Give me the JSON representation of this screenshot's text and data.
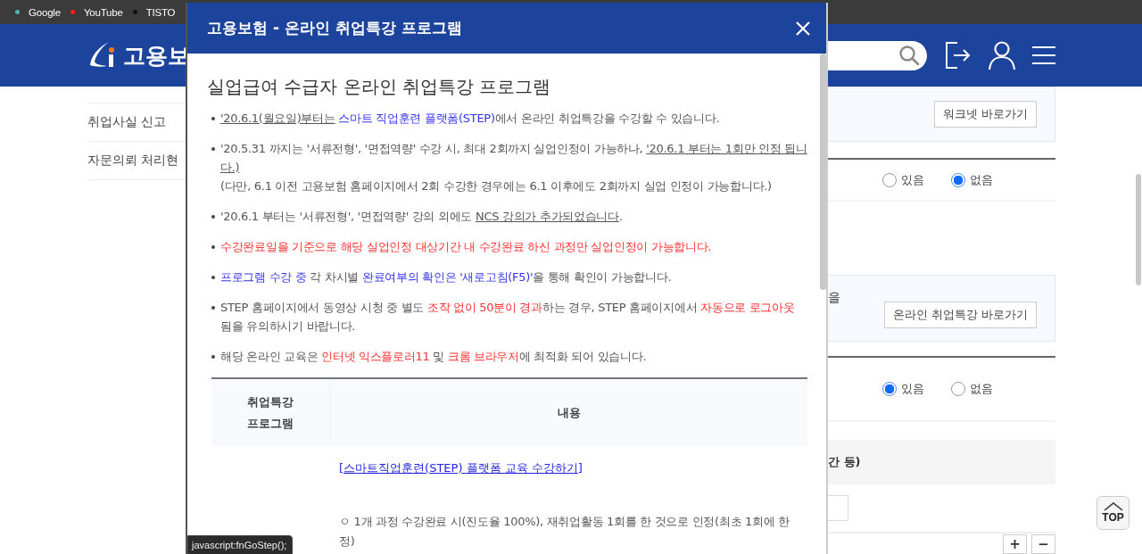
{
  "bookmarks": [
    {
      "label": "Google",
      "color": "#4db6ac"
    },
    {
      "label": "YouTube",
      "color": "#ff1a1a"
    },
    {
      "label": "TISTO",
      "color": "#111111"
    }
  ],
  "site_header": {
    "logo_text": "고용보"
  },
  "sidebar": {
    "items": [
      {
        "label": "취업사실 신고"
      },
      {
        "label": "자문의뢰 처리현"
      }
    ]
  },
  "content": {
    "panel_1": {
      "button": "워크넷 바로가기"
    },
    "radio_group_1": [
      {
        "label": "있음",
        "selected": false
      },
      {
        "label": "없음",
        "selected": true
      }
    ],
    "panel_2": {
      "text": "을",
      "button": "온라인 취업특강 바로가기"
    },
    "radio_group_2": [
      {
        "label": "있음",
        "selected": true
      },
      {
        "label": "없음",
        "selected": false
      }
    ],
    "section_heading": "간 등)",
    "stepper": [
      "+",
      "−"
    ]
  },
  "top_button": "TOP",
  "modal": {
    "title": "고용보험 - 온라인 취업특강 프로그램",
    "heading": "실업급여 수급자 온라인 취업특강 프로그램",
    "bullets": [
      {
        "segments": [
          {
            "text": "'20.6.1(월요일)부터는",
            "kind": "underline"
          },
          {
            "text": " 스마트 직업훈련 플랫폼(STEP)",
            "kind": "blue"
          },
          {
            "text": "에서 온라인 취업특강을 수강할 수 있습니다.",
            "kind": "plain"
          }
        ]
      },
      {
        "segments": [
          {
            "text": "'20.5.31 까지는 '서류전형', '면접역량' 수강 시, 최대 2회까지 실업인정이 가능하나, ",
            "kind": "plain"
          },
          {
            "text": "'20.6.1 부터는 1회만 인정 됩니다.)",
            "kind": "underline"
          }
        ],
        "note": "(다만, 6.1 이전 고용보험 홈페이지에서 2회 수강한 경우에는 6.1 이후에도 2회까지 실업 인정이 가능합니다.)"
      },
      {
        "segments": [
          {
            "text": "'20.6.1 부터는 '서류전형', '면접역량' 강의 외에도 ",
            "kind": "plain"
          },
          {
            "text": "NCS 강의가 추가되었습니다",
            "kind": "underline"
          },
          {
            "text": ".",
            "kind": "plain"
          }
        ]
      },
      {
        "segments": [
          {
            "text": "수강완료일을 기준으로 해당 실업인정 대상기간 내 수강완료 하신 과정만 실업인정이 가능합니다.",
            "kind": "red"
          }
        ]
      },
      {
        "segments": [
          {
            "text": "프로그램 수강 중",
            "kind": "blue"
          },
          {
            "text": " 각 차시별 ",
            "kind": "plain"
          },
          {
            "text": "완료여부의 확인은 '새로고침(F5)'",
            "kind": "blue"
          },
          {
            "text": "을 통해 확인이 가능합니다.",
            "kind": "plain"
          }
        ]
      },
      {
        "segments": [
          {
            "text": "STEP 홈페이지에서 동영상 시청 중 별도 ",
            "kind": "plain"
          },
          {
            "text": "조작 없이 50분이 경과",
            "kind": "red"
          },
          {
            "text": "하는 경우, STEP 홈페이지에서 ",
            "kind": "plain"
          },
          {
            "text": "자동으로 로그아웃",
            "kind": "red"
          },
          {
            "text": " 됨을 유의하시기 바랍니다.",
            "kind": "plain"
          }
        ]
      },
      {
        "segments": [
          {
            "text": "해당 온라인 교육은 ",
            "kind": "plain"
          },
          {
            "text": "인터넷 익스플로러11",
            "kind": "red"
          },
          {
            "text": " 및 ",
            "kind": "plain"
          },
          {
            "text": "크롬 브라우저",
            "kind": "red"
          },
          {
            "text": "에 최적화 되어 있습니다.",
            "kind": "plain"
          }
        ]
      }
    ],
    "table": {
      "columns": [
        "취업특강 프로그램",
        "내용"
      ],
      "rows": [
        {
          "link": "[스마트직업훈련(STEP) 플랫폼 교육 수강하기]",
          "items": [
            "ㅇ 1개 과정 수강완료 시(진도율 100%), 재취업활동 1회를 한 것으로 인정(최초 1회에 한정)"
          ]
        }
      ]
    }
  },
  "status_tooltip": "javascript:fnGoStep();"
}
